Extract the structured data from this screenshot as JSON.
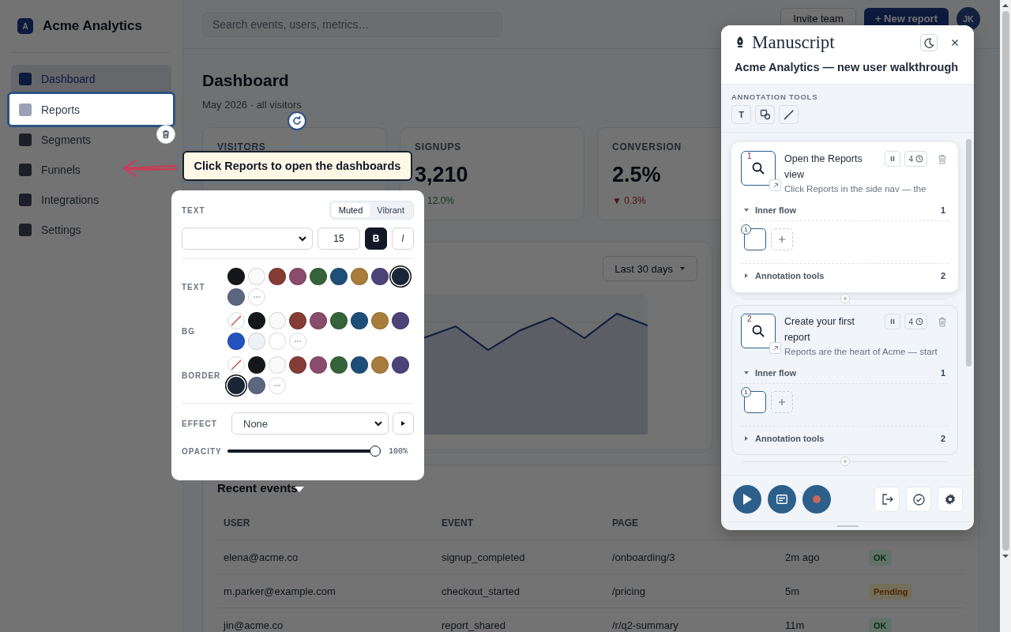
{
  "app": {
    "logo_letter": "A",
    "name": "Acme Analytics"
  },
  "sidebar": {
    "items": [
      {
        "label": "Dashboard",
        "selected": true,
        "spotlight": false
      },
      {
        "label": "Reports",
        "selected": false,
        "spotlight": true
      },
      {
        "label": "Segments",
        "selected": false,
        "spotlight": false
      },
      {
        "label": "Funnels",
        "selected": false,
        "spotlight": false
      },
      {
        "label": "Integrations",
        "selected": false,
        "spotlight": false
      },
      {
        "label": "Settings",
        "selected": false,
        "spotlight": false
      }
    ]
  },
  "topbar": {
    "search": {
      "placeholder": "Search events, users, metrics…"
    },
    "invite_button": "Invite team",
    "new_report_button": "+ New report",
    "avatar": "JK"
  },
  "page": {
    "title": "Dashboard",
    "subtitle": "May 2026 · all visitors"
  },
  "stats": [
    {
      "label": "VISITORS"
    },
    {
      "label": "SIGNUPS",
      "value": "3,210",
      "delta": "12.0%",
      "positive": true
    },
    {
      "label": "CONVERSION",
      "value": "2.5%",
      "delta": "▼ 0.3%",
      "positive": false
    }
  ],
  "chart_card": {
    "range_button": "Last 30 days"
  },
  "events": {
    "title": "Recent events",
    "columns": [
      "USER",
      "EVENT",
      "PAGE"
    ],
    "rows": [
      {
        "user": "elena@acme.co",
        "event": "signup_completed",
        "page": "/onboarding/3",
        "time": "2m ago",
        "status": "OK",
        "kind": "ok"
      },
      {
        "user": "m.parker@example.com",
        "event": "checkout_started",
        "page": "/pricing",
        "time": "5m",
        "status": "Pending",
        "kind": "pending"
      },
      {
        "user": "jin@acme.co",
        "event": "report_shared",
        "page": "/r/q2-summary",
        "time": "11m",
        "status": "OK",
        "kind": "ok"
      }
    ]
  },
  "tooltip": {
    "text": "Click Reports to open the dashboards"
  },
  "style_popover": {
    "section_label": "TEXT",
    "modes": [
      {
        "label": "Muted",
        "selected": true
      },
      {
        "label": "Vibrant",
        "selected": false
      }
    ],
    "font_size": "15",
    "bold": {
      "label": "B",
      "on": true
    },
    "italic": {
      "label": "I",
      "on": false
    },
    "swatch_groups": [
      {
        "label": "TEXT",
        "swatches": [
          {
            "kind": "color",
            "color": "#15171a",
            "selected": false
          },
          {
            "kind": "color",
            "color": "#fafafa",
            "selected": false
          },
          {
            "kind": "color",
            "color": "#843c35",
            "selected": false
          },
          {
            "kind": "color",
            "color": "#8a4c6c",
            "selected": false
          },
          {
            "kind": "color",
            "color": "#36633a",
            "selected": false
          },
          {
            "kind": "color",
            "color": "#1f4e79",
            "selected": false
          },
          {
            "kind": "color",
            "color": "#a87c3a",
            "selected": false
          },
          {
            "kind": "color",
            "color": "#4c4478",
            "selected": false
          },
          {
            "kind": "color",
            "color": "#1b2538",
            "selected": true
          },
          {
            "kind": "color",
            "color": "#5b6680",
            "selected": false
          },
          {
            "kind": "more",
            "selected": false
          }
        ]
      },
      {
        "label": "BG",
        "swatches": [
          {
            "kind": "none",
            "selected": false
          },
          {
            "kind": "color",
            "color": "#15171a",
            "selected": false
          },
          {
            "kind": "color",
            "color": "#fafafa",
            "selected": false
          },
          {
            "kind": "color",
            "color": "#843c35",
            "selected": false
          },
          {
            "kind": "color",
            "color": "#8a4c6c",
            "selected": false
          },
          {
            "kind": "color",
            "color": "#36633a",
            "selected": false
          },
          {
            "kind": "color",
            "color": "#1f4e79",
            "selected": false
          },
          {
            "kind": "color",
            "color": "#a87c3a",
            "selected": false
          },
          {
            "kind": "color",
            "color": "#4c4478",
            "selected": false
          },
          {
            "kind": "color",
            "color": "#2453c0",
            "selected": false
          },
          {
            "kind": "color",
            "color": "#eef1f8",
            "selected": false
          },
          {
            "kind": "color",
            "color": "#ffffff",
            "selected": false
          },
          {
            "kind": "more",
            "selected": false
          }
        ]
      },
      {
        "label": "BORDER",
        "swatches": [
          {
            "kind": "none",
            "selected": false
          },
          {
            "kind": "color",
            "color": "#15171a",
            "selected": false
          },
          {
            "kind": "color",
            "color": "#fafafa",
            "selected": false
          },
          {
            "kind": "color",
            "color": "#843c35",
            "selected": false
          },
          {
            "kind": "color",
            "color": "#8a4c6c",
            "selected": false
          },
          {
            "kind": "color",
            "color": "#36633a",
            "selected": false
          },
          {
            "kind": "color",
            "color": "#1f4e79",
            "selected": false
          },
          {
            "kind": "color",
            "color": "#a87c3a",
            "selected": false
          },
          {
            "kind": "color",
            "color": "#4c4478",
            "selected": false
          },
          {
            "kind": "color",
            "color": "#1b2538",
            "selected": true
          },
          {
            "kind": "color",
            "color": "#5b6680",
            "selected": false
          },
          {
            "kind": "more",
            "selected": false
          }
        ]
      }
    ],
    "effect_label": "EFFECT",
    "effect": "None",
    "opacity_label": "OPACITY",
    "opacity": {
      "level": 1,
      "reading": "100%"
    }
  },
  "manuscript": {
    "title": "Manuscript",
    "subtitle": "Acme Analytics — new user walkthrough",
    "tools_label": "ANNOTATION TOOLS",
    "tools": [
      {
        "kind": "text",
        "label": "T"
      },
      {
        "kind": "shape"
      },
      {
        "kind": "brush"
      }
    ],
    "steps": [
      {
        "number": "1",
        "title": "Open the Reports view",
        "description": "Click Reports in the side nav — the",
        "duration": "4",
        "selected": true,
        "sections": [
          {
            "label": "Inner flow",
            "count": "1",
            "expanded": true,
            "items": [
              {
                "number": "1"
              }
            ]
          },
          {
            "label": "Annotation tools",
            "count": "2",
            "expanded": false
          }
        ]
      },
      {
        "number": "2",
        "title": "Create your first report",
        "description": "Reports are the heart of Acme — start",
        "duration": "4",
        "selected": false,
        "sections": [
          {
            "label": "Inner flow",
            "count": "1",
            "expanded": true,
            "items": [
              {
                "number": "1"
              }
            ]
          },
          {
            "label": "Annotation tools",
            "count": "2",
            "expanded": false
          }
        ]
      }
    ]
  }
}
